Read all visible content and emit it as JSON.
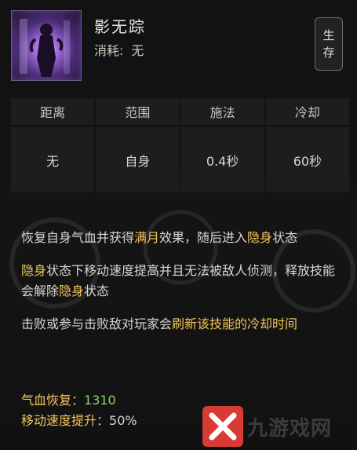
{
  "header": {
    "skill_name": "影无踪",
    "cost_label": "消耗:",
    "cost_value": "无",
    "store_button_top": "生",
    "store_button_bottom": "存"
  },
  "stats_table": {
    "headers": [
      "距离",
      "范围",
      "施法",
      "冷却"
    ],
    "values": [
      "无",
      "自身",
      "0.4秒",
      "60秒"
    ]
  },
  "description": {
    "p1_a": "恢复自身气血并获得",
    "p1_hl1": "满月",
    "p1_b": "效果，随后进入",
    "p1_hl2": "隐身",
    "p1_c": "状态",
    "p2_hl1": "隐身",
    "p2_a": "状态下移动速度提高并且无法被敌人侦测，释放技能会解除",
    "p2_hl2": "隐身",
    "p2_b": "状态",
    "p3_a": "击败或参与击败敌对玩家会",
    "p3_hl": "刷新该技能的冷却时间"
  },
  "bonuses": {
    "hp_label": "气血恢复：",
    "hp_value": "1310",
    "speed_label": "移动速度提升：",
    "speed_value": "50%"
  },
  "watermark": {
    "text": "九游戏网"
  },
  "colors": {
    "highlight": "#f3c65a",
    "positive": "#8bd46a",
    "background": "#121213",
    "cell": "#1d1d1e",
    "watermark": "#d83a34"
  }
}
